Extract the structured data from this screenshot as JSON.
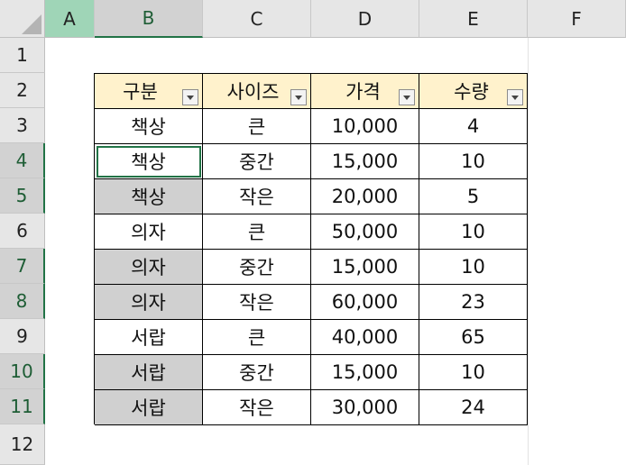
{
  "columns": [
    "A",
    "B",
    "C",
    "D",
    "E",
    "F"
  ],
  "rows": [
    "1",
    "2",
    "3",
    "4",
    "5",
    "6",
    "7",
    "8",
    "9",
    "10",
    "11",
    "12"
  ],
  "table": {
    "headers": [
      "구분",
      "사이즈",
      "가격",
      "수량"
    ],
    "rows": [
      [
        "책상",
        "큰",
        "10,000",
        "4"
      ],
      [
        "책상",
        "중간",
        "15,000",
        "10"
      ],
      [
        "책상",
        "작은",
        "20,000",
        "5"
      ],
      [
        "의자",
        "큰",
        "50,000",
        "10"
      ],
      [
        "의자",
        "중간",
        "15,000",
        "10"
      ],
      [
        "의자",
        "작은",
        "60,000",
        "23"
      ],
      [
        "서랍",
        "큰",
        "40,000",
        "65"
      ],
      [
        "서랍",
        "중간",
        "15,000",
        "10"
      ],
      [
        "서랍",
        "작은",
        "30,000",
        "24"
      ]
    ]
  },
  "colors": {
    "header_fill": "#fff2cc",
    "gray_fill": "#d0d0d0",
    "selection_green": "#217346"
  },
  "icons": {
    "filter": "filter-dropdown-icon",
    "select_all": "select-all-triangle-icon"
  }
}
